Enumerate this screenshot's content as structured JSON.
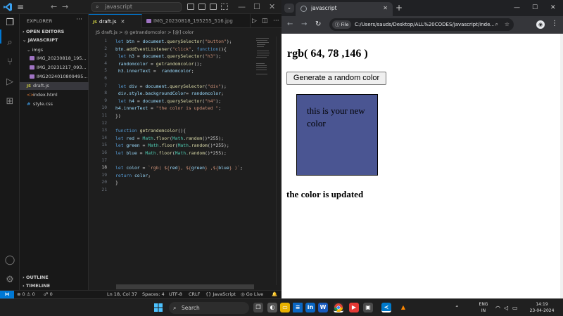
{
  "vscode": {
    "search_text": "javascript",
    "explorer_title": "EXPLORER",
    "open_editors": "OPEN EDITORS",
    "folder": "JAVASCRIPT",
    "tree": [
      "imgs",
      "IMG_20230818_195...",
      "IMG_20231217_093...",
      "IMG2024010809495...",
      "draft.js",
      "index.html",
      "style.css"
    ],
    "outline": "OUTLINE",
    "timeline": "TIMELINE",
    "tabs": [
      "draft.js",
      "IMG_20230818_195255_516.jpg"
    ],
    "breadcrumb": "JS draft.js > ◎ getrandomcolor > [@] color",
    "line_numbers": [
      "1",
      "2",
      "3",
      "4",
      "5",
      "6",
      "7",
      "8",
      "9",
      "10",
      "11",
      "12",
      "13",
      "14",
      "15",
      "16",
      "17",
      "18",
      "19",
      "20",
      "21"
    ],
    "status": {
      "errors": "⊗ 0 ⚠ 0",
      "ports": "☍ 0",
      "position": "Ln 18, Col 37",
      "spaces": "Spaces: 4",
      "encoding": "UTF-8",
      "eol": "CRLF",
      "language": "{} JavaScript",
      "golive": "◎ Go Live",
      "bell": "🔔"
    }
  },
  "browser": {
    "tab_title": "javascript",
    "url_chip": "File",
    "url": "C:/Users/sauds/Desktop/ALL%20CODES/javascript/inde...",
    "page": {
      "heading": "rgb( 64, 78 ,146 )",
      "button": "Generate a random color",
      "box_text": "this is your new color",
      "box_color": "#4a5592",
      "updated": "the color is updated"
    }
  },
  "taskbar": {
    "search": "Search",
    "lang_1": "ENG",
    "lang_2": "IN",
    "time": "14:19",
    "date": "23-04-2024"
  },
  "colors": {
    "accent": "#0078d4",
    "editor_bg": "#1e1e1e"
  }
}
